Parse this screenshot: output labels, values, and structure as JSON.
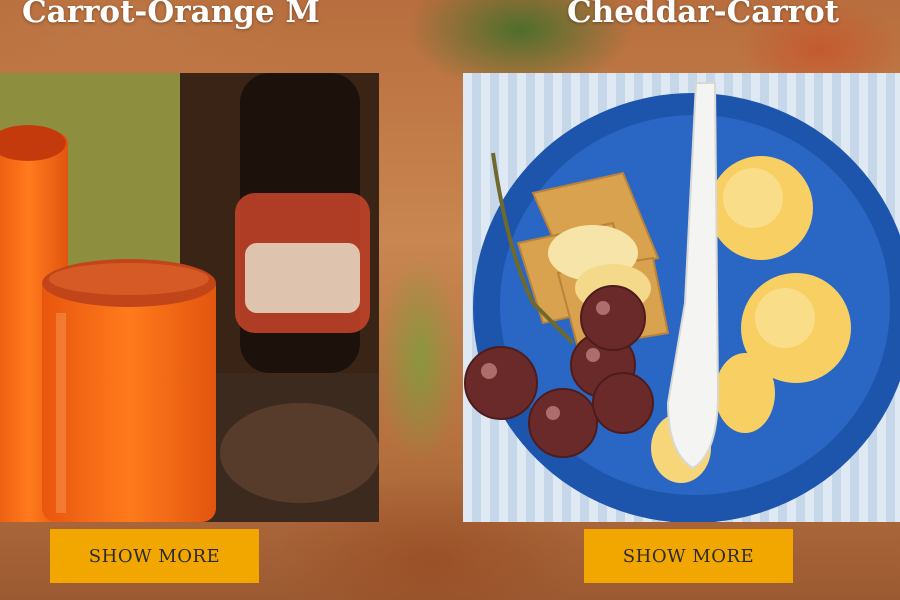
{
  "cards": [
    {
      "title": "Carrot-Orange M",
      "button_label": "SHOW MORE"
    },
    {
      "title": "Cheddar-Carrot",
      "button_label": "SHOW MORE"
    }
  ],
  "colors": {
    "button": "#f2a600",
    "title_text": "#ffffff",
    "plate_blue": "#1f57b0"
  }
}
